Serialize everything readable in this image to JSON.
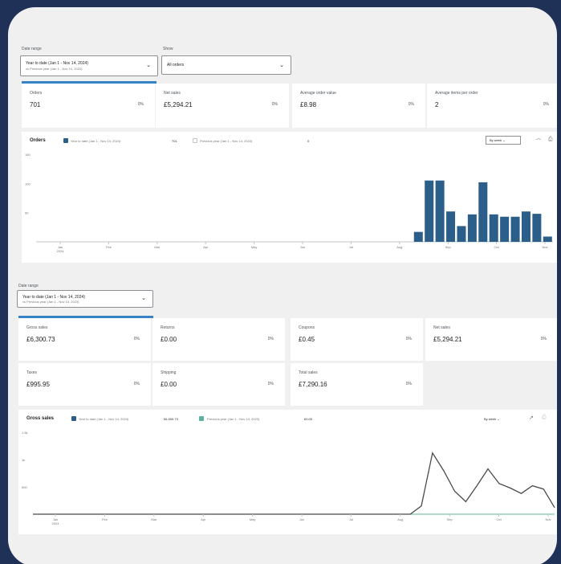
{
  "filters": {
    "date_label": "Date range",
    "date_value": "Year to date (Jan 1 - Nov 14, 2024)",
    "date_compare": "vs Previous year (Jan 1 - Nov 14, 2023)",
    "show_label": "Show",
    "show_value": "All orders"
  },
  "top_cards": [
    {
      "title": "Orders",
      "value": "701",
      "pct": "0%"
    },
    {
      "title": "Net sales",
      "value": "£5,294.21",
      "pct": "0%"
    },
    {
      "title": "Average order value",
      "value": "£8.98",
      "pct": "0%"
    },
    {
      "title": "Average items per order",
      "value": "2",
      "pct": "0%"
    }
  ],
  "orders_chart": {
    "title": "Orders",
    "legend1": "Year to date (Jan 1 - Nov 14, 2024)",
    "legend1_value": "701",
    "legend2": "Previous year (Jan 1 - Nov 14, 2023)",
    "legend2_value": "0",
    "interval": "By week",
    "series_color": "#2b5f8a"
  },
  "section2": {
    "date_label": "Date range",
    "date_value": "Year to date (Jan 1 - Nov 14, 2024)",
    "date_compare": "vs Previous year (Jan 1 - Nov 14, 2023)"
  },
  "revenue_cards": [
    {
      "title": "Gross sales",
      "value": "£6,300.73",
      "pct": "0%"
    },
    {
      "title": "Returns",
      "value": "£0.00",
      "pct": "0%"
    },
    {
      "title": "Coupons",
      "value": "£0.45",
      "pct": "0%"
    },
    {
      "title": "Net sales",
      "value": "£5,294.21",
      "pct": "0%"
    },
    {
      "title": "Taxes",
      "value": "£995.95",
      "pct": "0%"
    },
    {
      "title": "Shipping",
      "value": "£0.00",
      "pct": "0%"
    },
    {
      "title": "Total sales",
      "value": "£7,290.16",
      "pct": "0%"
    }
  ],
  "gross_chart": {
    "title": "Gross sales",
    "legend1": "Year to date (Jan 1 - Nov 14, 2024)",
    "legend1_value": "£6,300.73",
    "legend2": "Previous year (Jan 1 - Nov 14, 2023)",
    "legend2_value": "£0.00",
    "interval": "By week",
    "line_color": "#4a4a4a",
    "compare_color": "#5ab3a0"
  },
  "chart_data": [
    {
      "type": "bar",
      "title": "Orders",
      "ylim": [
        0,
        150
      ],
      "y_ticks": [
        "150",
        "100",
        "50"
      ],
      "x_ticks": [
        "Jan 2024",
        "Feb",
        "Mar",
        "Apr",
        "May",
        "Jun",
        "Jul",
        "Aug",
        "Sep",
        "Oct",
        "Nov"
      ],
      "series": [
        {
          "name": "Year to date (Jan 1 - Nov 14, 2024)",
          "values": [
            0,
            0,
            0,
            0,
            0,
            0,
            0,
            0,
            0,
            0,
            0,
            0,
            0,
            0,
            0,
            0,
            0,
            0,
            0,
            0,
            0,
            0,
            0,
            0,
            0,
            0,
            0,
            0,
            0,
            0,
            0,
            0,
            0,
            0,
            0,
            17,
            105,
            105,
            52,
            27,
            47,
            102,
            47,
            43,
            43,
            52,
            48,
            9
          ]
        }
      ]
    },
    {
      "type": "line",
      "title": "Gross sales",
      "ylim": [
        0,
        1500
      ],
      "y_ticks": [
        "1.5k",
        "1k",
        "500"
      ],
      "x_ticks": [
        "Jan 2024",
        "Feb",
        "Mar",
        "Apr",
        "May",
        "Jun",
        "Jul",
        "Aug",
        "Sep",
        "Oct",
        "Nov"
      ],
      "series": [
        {
          "name": "Year to date (Jan 1 - Nov 14, 2024)",
          "values": [
            0,
            0,
            0,
            0,
            0,
            0,
            0,
            0,
            0,
            0,
            0,
            0,
            0,
            0,
            0,
            0,
            0,
            0,
            0,
            0,
            0,
            0,
            0,
            0,
            0,
            0,
            0,
            0,
            0,
            0,
            0,
            0,
            0,
            0,
            0,
            150,
            1120,
            800,
            420,
            230,
            520,
            830,
            560,
            480,
            380,
            520,
            460,
            120
          ]
        },
        {
          "name": "Previous year (Jan 1 - Nov 14, 2023)",
          "values": [
            0,
            0,
            0,
            0,
            0,
            0,
            0,
            0,
            0,
            0,
            0,
            0,
            0,
            0,
            0,
            0,
            0,
            0,
            0,
            0,
            0,
            0,
            0,
            0,
            0,
            0,
            0,
            0,
            0,
            0,
            0,
            0,
            0,
            0,
            0,
            0,
            0,
            0,
            0,
            0,
            0,
            0,
            0,
            0,
            0,
            0,
            0,
            0
          ]
        }
      ]
    }
  ]
}
